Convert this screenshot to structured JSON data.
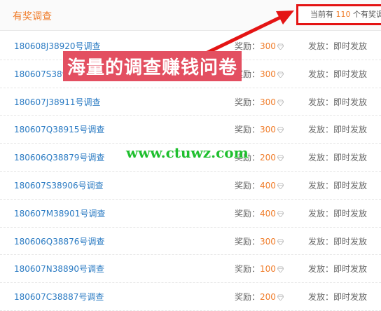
{
  "header": {
    "title": "有奖调查",
    "count_prefix": "当前有 ",
    "count_value": "110",
    "count_suffix": " 个有奖调查"
  },
  "labels": {
    "reward": "奖励：",
    "distribution": "发放："
  },
  "surveys": [
    {
      "title": "180608J38920号调查",
      "points": "300",
      "distribution": "即时发放"
    },
    {
      "title": "180607S38919号调查",
      "points": "300",
      "distribution": "即时发放"
    },
    {
      "title": "180607J38911号调查",
      "points": "300",
      "distribution": "即时发放"
    },
    {
      "title": "180607Q38915号调查",
      "points": "300",
      "distribution": "即时发放"
    },
    {
      "title": "180606Q38879号调查",
      "points": "200",
      "distribution": "即时发放"
    },
    {
      "title": "180607S38906号调查",
      "points": "400",
      "distribution": "即时发放"
    },
    {
      "title": "180607M38901号调查",
      "points": "400",
      "distribution": "即时发放"
    },
    {
      "title": "180606Q38876号调查",
      "points": "300",
      "distribution": "即时发放"
    },
    {
      "title": "180607N38890号调查",
      "points": "100",
      "distribution": "即时发放"
    },
    {
      "title": "180607C38887号调查",
      "points": "200",
      "distribution": "即时发放"
    }
  ],
  "overlay": {
    "slogan": "海量的调查赚钱问卷",
    "url": "www.ctuwz.com"
  },
  "colors": {
    "accent": "#f07c29",
    "link": "#2b7bc3",
    "highlight_box": "#e41414",
    "slogan_bg": "#e34f61",
    "url_text": "#1fbf2e"
  },
  "icons": {
    "reward_unit": "diamond-icon"
  }
}
